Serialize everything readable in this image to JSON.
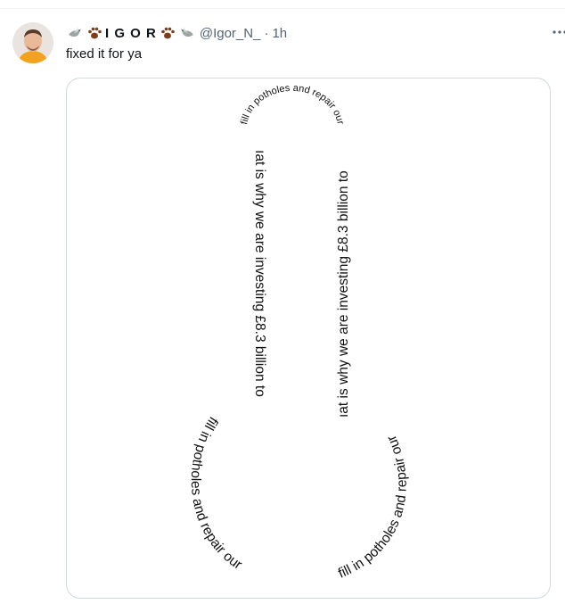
{
  "tweet": {
    "display_name": "I G O R",
    "handle": "@Igor_N_",
    "separator": "·",
    "time": "1h",
    "text": "fixed it for ya",
    "more_icon": "more-icon",
    "avatar_icon": "avatar-photo"
  },
  "image_text": {
    "left_shaft": "ıat is why we are investing £8.3 billion to",
    "right_shaft": "ıat is why we are investing £8.3 billion to",
    "top_arc": "fill in potholes and repair our",
    "left_ball": "fill in potholes and repair our",
    "right_ball": "fill in potholes and repair our"
  },
  "colors": {
    "text_primary": "#0f1419",
    "text_secondary": "#536471",
    "border": "#cfd9de"
  }
}
